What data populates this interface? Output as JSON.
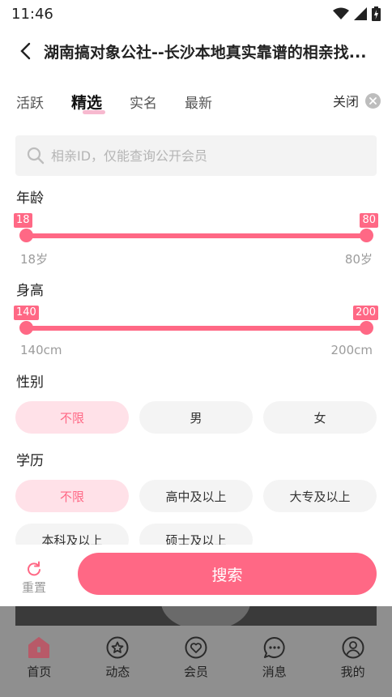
{
  "status_bar": {
    "time": "11:46",
    "wifi_icon": "wifi-icon",
    "signal_icon": "signal-icon",
    "battery_icon": "battery-charging-icon"
  },
  "header": {
    "back_icon": "chevron-left-icon",
    "title": "湖南搞对象公社--长沙本地真实靠谱的相亲找..."
  },
  "filter_tabs": [
    {
      "label": "活跃",
      "active": false
    },
    {
      "label": "精选",
      "active": true
    },
    {
      "label": "实名",
      "active": false
    },
    {
      "label": "最新",
      "active": false
    }
  ],
  "close": {
    "label": "关闭",
    "icon": "close-circle-icon"
  },
  "search": {
    "placeholder": "相亲ID，仅能查询公开会员",
    "value": "",
    "icon": "search-icon"
  },
  "age": {
    "label": "年龄",
    "min_badge": "18",
    "max_badge": "80",
    "min_caption": "18岁",
    "max_caption": "80岁",
    "selected_min": 18,
    "selected_max": 80
  },
  "height": {
    "label": "身高",
    "min_badge": "140",
    "max_badge": "200",
    "min_caption": "140cm",
    "max_caption": "200cm",
    "selected_min": 140,
    "selected_max": 200
  },
  "gender": {
    "label": "性别",
    "options": [
      "不限",
      "男",
      "女"
    ],
    "selected": "不限"
  },
  "education": {
    "label": "学历",
    "options": [
      "不限",
      "高中及以上",
      "大专及以上",
      "本科及以上",
      "硕士及以上"
    ],
    "selected": "不限"
  },
  "actions": {
    "reset_label": "重置",
    "reset_icon": "refresh-icon",
    "search_label": "搜索"
  },
  "colors": {
    "accent": "#ff6885",
    "accent_light": "#ffe1e8",
    "chip_bg": "#f4f4f4",
    "overlay": "#8f8f8f"
  },
  "tabbar": [
    {
      "label": "首页",
      "icon": "home-icon",
      "active": true
    },
    {
      "label": "动态",
      "icon": "star-circle-icon",
      "active": false
    },
    {
      "label": "会员",
      "icon": "heart-circle-icon",
      "active": false
    },
    {
      "label": "消息",
      "icon": "chat-bubble-icon",
      "active": false
    },
    {
      "label": "我的",
      "icon": "user-circle-icon",
      "active": false
    }
  ]
}
